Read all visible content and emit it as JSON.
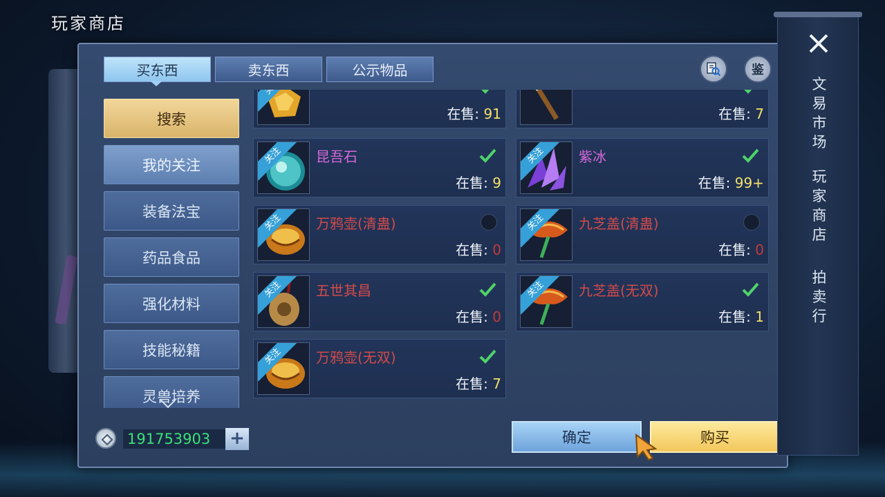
{
  "page_title": "玩家商店",
  "tabs": [
    {
      "label": "买东西",
      "active": true
    },
    {
      "label": "卖东西",
      "active": false
    },
    {
      "label": "公示物品",
      "active": false
    }
  ],
  "top_icons": {
    "search_icon": "magnifier-scroll-icon",
    "appraise_label": "鉴"
  },
  "categories": [
    {
      "label": "搜索",
      "style": "search"
    },
    {
      "label": "我的关注",
      "style": "fav"
    },
    {
      "label": "装备法宝",
      "style": "normal"
    },
    {
      "label": "药品食品",
      "style": "normal"
    },
    {
      "label": "强化材料",
      "style": "normal"
    },
    {
      "label": "技能秘籍",
      "style": "normal"
    },
    {
      "label": "灵兽培养",
      "style": "normal"
    }
  ],
  "sale_label": "在售:",
  "badge_label": "关注",
  "items": [
    {
      "name": "",
      "sale": "91",
      "checked": true,
      "partial": true,
      "icon": "amber-gem-icon"
    },
    {
      "name": "",
      "sale": "7",
      "checked": true,
      "partial": true,
      "icon": "brush-icon"
    },
    {
      "name": "昆吾石",
      "name_color": "purple",
      "sale": "9",
      "checked": true,
      "icon": "jade-orb-icon"
    },
    {
      "name": "紫冰",
      "name_color": "purple",
      "sale": "99+",
      "checked": true,
      "icon": "purple-crystal-icon"
    },
    {
      "name": "万鸦壶(清蛊)",
      "name_color": "red",
      "sale": "0",
      "checked": false,
      "icon": "golden-pot-icon"
    },
    {
      "name": "九芝盖(清蛊)",
      "name_color": "red",
      "sale": "0",
      "checked": false,
      "icon": "lingzhi-fan-icon"
    },
    {
      "name": "五世其昌",
      "name_color": "red",
      "sale": "0",
      "checked": true,
      "icon": "bronze-medallion-icon"
    },
    {
      "name": "九芝盖(无双)",
      "name_color": "red",
      "sale": "1",
      "checked": true,
      "icon": "lingzhi-fan-icon"
    },
    {
      "name": "万鸦壶(无双)",
      "name_color": "red",
      "sale": "7",
      "checked": true,
      "icon": "golden-pot-icon"
    }
  ],
  "currency": {
    "amount": "191753903",
    "plus_label": "+"
  },
  "buttons": {
    "confirm": "确定",
    "buy": "购买"
  },
  "side_menu": {
    "close_icon": "close-x-icon",
    "group1": "文易市场",
    "group2": "玩家商店",
    "group3": "拍卖行"
  },
  "colors": {
    "accent_blue": "#8ec6ef",
    "buy_gold": "#f2c75b",
    "sale_count": "#f2e06a",
    "zero_count": "#c23a3a",
    "currency_green": "#3be07a"
  }
}
